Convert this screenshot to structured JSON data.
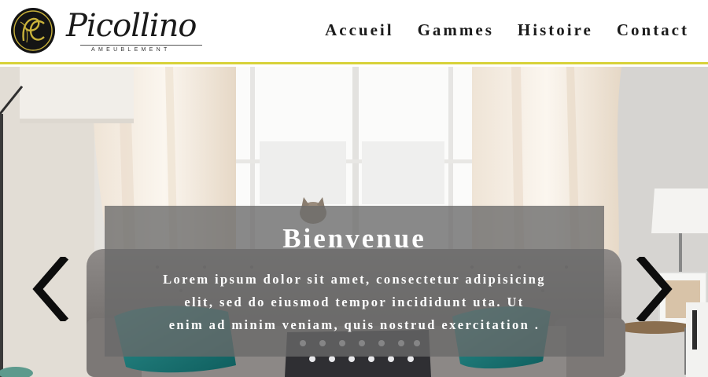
{
  "brand": {
    "name": "Picollino",
    "subtitle": "AMEUBLEMENT",
    "emblem_text": "PC",
    "colors": {
      "emblem_bg": "#141414",
      "emblem_gold": "#c9b23a",
      "accent": "#d8d23a"
    }
  },
  "nav": {
    "items": [
      {
        "label": "Accueil"
      },
      {
        "label": "Gammes"
      },
      {
        "label": "Histoire"
      },
      {
        "label": "Contact"
      }
    ]
  },
  "hero": {
    "title": "Bienvenue",
    "lines": [
      "Lorem ipsum dolor sit amet, consectetur adipisicing",
      "elit, sed do eiusmod tempor incididunt uta. Ut",
      "enim ad minim veniam, quis nostrud exercitation ."
    ],
    "prev_icon": "chevron-left-icon",
    "next_icon": "chevron-right-icon"
  }
}
